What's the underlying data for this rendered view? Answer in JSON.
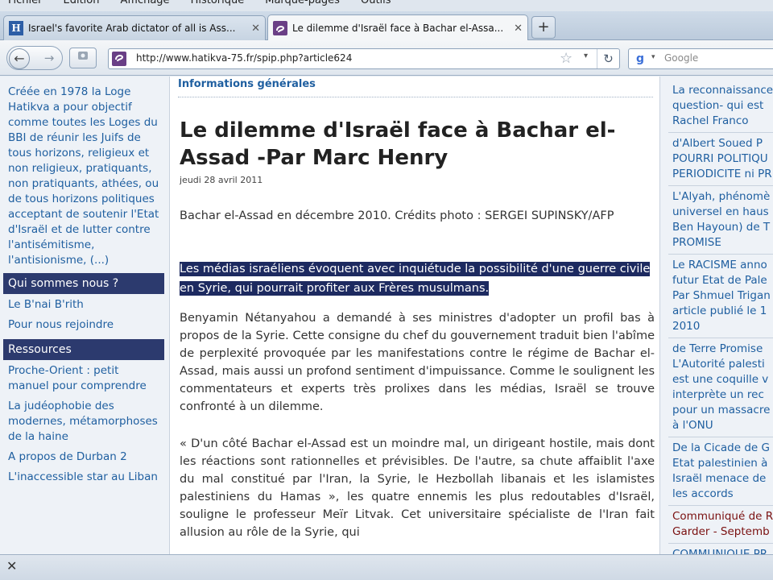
{
  "browser": {
    "menu": [
      "Fichier",
      "Édition",
      "Affichage",
      "Historique",
      "Marque-pages",
      "Outils"
    ],
    "tabs": [
      {
        "title": "Israel's favorite Arab dictator of all is Ass...",
        "favicon": "H",
        "active": false
      },
      {
        "title": "Le dilemme d'Israël face à Bachar el-Assa...",
        "favicon": "spip",
        "active": true
      }
    ],
    "new_tab_label": "+",
    "url": "http://www.hatikva-75.fr/spip.php?article624",
    "search_placeholder": "Google",
    "close_label": "✕"
  },
  "sidebar_left": {
    "intro": "Créée en 1978 la Loge Hatikva a pour objectif comme toutes les Loges du BBI de réunir les Juifs de tous horizons, religieux et non religieux, pratiquants, non pratiquants, athées, ou de tous horizons politiques acceptant de soutenir l'Etat d'Israël et de lutter contre l'antisémitisme, l'antisionisme, (...)",
    "section1_title": "Qui sommes nous ?",
    "section1_links": [
      "Le B'nai B'rith",
      "Pour nous rejoindre"
    ],
    "section2_title": "Ressources",
    "section2_links": [
      "Proche-Orient : petit manuel pour comprendre",
      "La judéophobie des modernes, métamorphoses de la haine",
      "A propos de Durban 2",
      "L'inaccessible star au Liban"
    ]
  },
  "article": {
    "rubrique": "Informations générales",
    "title": "Le dilemme d'Israël face à Bachar el-Assad -Par Marc Henry",
    "date": "jeudi 28 avril 2011",
    "photo_caption": "Bachar el-Assad en décembre 2010. Crédits photo : SERGEI SUPINSKY/AFP",
    "chapo": "Les médias israéliens évoquent avec inquiétude la possibilité d'une guerre civile en Syrie, qui pourrait profiter aux Frères musulmans.",
    "paragraph1": "Benyamin Nétanyahou a demandé à ses ministres d'adopter un profil bas à propos de la Syrie. Cette consigne du chef du gouvernement traduit bien l'abîme de perplexité provoquée par les manifestations contre le régime de Bachar el-Assad, mais aussi un profond sentiment d'impuissance. Comme le soulignent les commentateurs et experts très prolixes dans les médias, Israël se trouve confronté à un dilemme.",
    "paragraph2": "« D'un côté Bachar el-Assad est un moindre mal, un dirigeant hostile, mais dont les réactions sont rationnelles et prévisibles. De l'autre, sa chute affaiblit l'axe du mal constitué par l'Iran, la Syrie, le Hezbollah libanais et les islamistes palestiniens du Hamas », les quatre ennemis les plus redoutables d'Israël, souligne le professeur Meïr Litvak. Cet universitaire spécialiste de l'Iran fait allusion au rôle de la Syrie, qui"
  },
  "sidebar_right": {
    "items": [
      {
        "lines": [
          "La reconnaissance",
          "question- qui est",
          "Rachel Franco"
        ],
        "tone": "blue"
      },
      {
        "lines": [
          "d'Albert Soued P",
          "POURRI POLITIQU",
          "PERIODICITE ni PR"
        ],
        "tone": "blue"
      },
      {
        "lines": [
          "L'Alyah, phénomè",
          "universel en haus",
          "Ben Hayoun) de T",
          "PROMISE"
        ],
        "tone": "blue"
      },
      {
        "lines": [
          "Le RACISME anno",
          "futur Etat de Pale",
          "Par Shmuel Trigan",
          "article publié le 1",
          "2010"
        ],
        "tone": "blue"
      },
      {
        "lines": [
          "de Terre Promise",
          "L'Autorité palesti",
          "est une coquille v",
          "interprète un rec",
          "pour un massacre",
          "à l'ONU"
        ],
        "tone": "blue"
      },
      {
        "lines": [
          "De la Cicade de G",
          "Etat palestinien à",
          "Israël menace de",
          "les accords"
        ],
        "tone": "blue"
      },
      {
        "lines": [
          "Communiqué de R",
          "Garder - Septemb"
        ],
        "tone": "red"
      },
      {
        "lines": [
          "COMMUNIQUE PR"
        ],
        "tone": "blue"
      }
    ]
  },
  "colors": {
    "link": "#1f5fa0",
    "nav_header": "#2c3a6e",
    "selection": "#1d2a60",
    "red_link": "#7a1010"
  },
  "icons": {
    "back": "back-arrow-icon",
    "forward": "forward-arrow-icon",
    "star": "bookmark-star-icon",
    "reload": "reload-icon",
    "search_engine": "google-icon"
  }
}
